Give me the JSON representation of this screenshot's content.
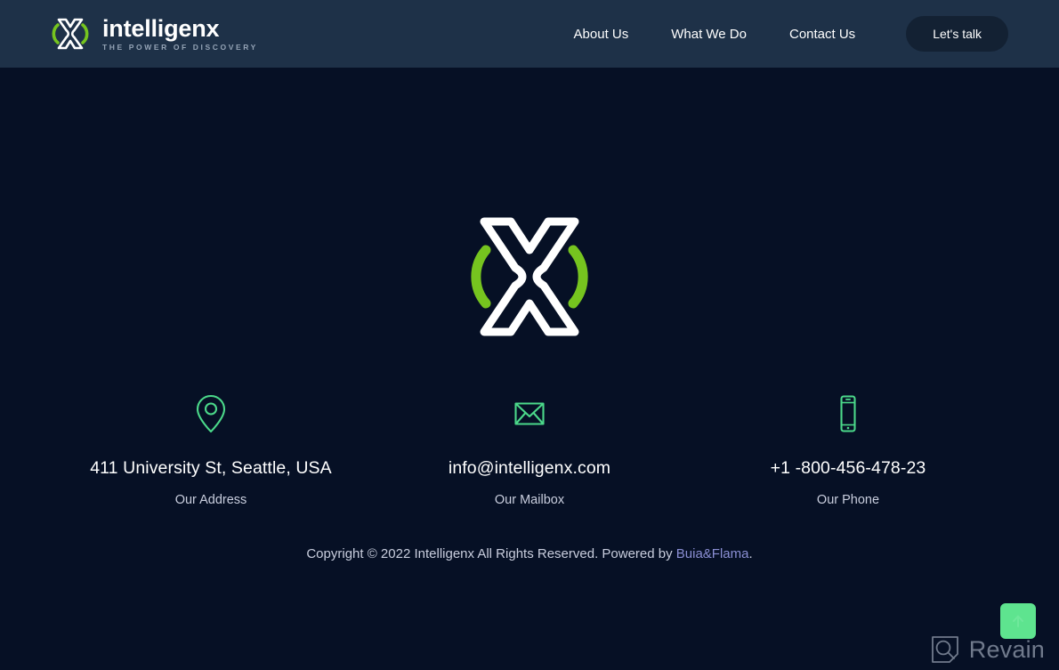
{
  "header": {
    "brand": {
      "name": "intelligenx",
      "tagline": "THE POWER OF DISCOVERY",
      "logo_icon": "intelligenx-x-logo-icon"
    },
    "nav": [
      {
        "label": "About Us"
      },
      {
        "label": "What We Do"
      },
      {
        "label": "Contact Us"
      }
    ],
    "cta": {
      "label": "Let's talk"
    },
    "background_color": "#1e3148"
  },
  "footer": {
    "logo_icon": "intelligenx-x-logo-large-icon",
    "background_color": "#061025",
    "accent_green": "#76c41f",
    "icon_green": "#4bd98a",
    "contacts": [
      {
        "icon": "location-pin-icon",
        "value": "411 University St, Seattle, USA",
        "label": "Our Address"
      },
      {
        "icon": "envelope-icon",
        "value": "info@intelligenx.com",
        "label": "Our Mailbox"
      },
      {
        "icon": "mobile-phone-icon",
        "value": "+1 -800-456-478-23",
        "label": "Our Phone"
      }
    ],
    "copyright": {
      "before_link": "Copyright © 2022 Intelligenx All Rights Reserved. Powered by ",
      "link_label": "Buia&Flama",
      "after_link": ".",
      "link_color": "#8b8fd4"
    }
  },
  "floating": {
    "scroll_top": {
      "icon": "arrow-up-icon",
      "color": "#5ee48f"
    },
    "watermark": {
      "icon": "revain-magnifier-icon",
      "label": "Revain"
    }
  }
}
